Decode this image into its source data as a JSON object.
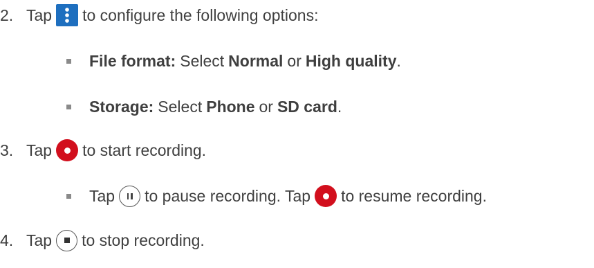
{
  "steps": {
    "s2": {
      "num": "2.",
      "pre": "Tap",
      "post": "to configure the following options:",
      "icon": "more-vert-icon",
      "icon_color": "#1e6fbf"
    },
    "opt1": {
      "label": "File format:",
      "t1": "Select",
      "b1": "Normal",
      "t2": "or",
      "b2": "High quality",
      "end": "."
    },
    "opt2": {
      "label": "Storage:",
      "t1": "Select",
      "b1": "Phone",
      "t2": "or",
      "b2": "SD card",
      "end": "."
    },
    "s3": {
      "num": "3.",
      "pre": "Tap",
      "post": "to start recording.",
      "icon": "record-icon",
      "icon_color": "#d20f1d"
    },
    "s3sub": {
      "pre": "Tap",
      "mid": "to pause recording. Tap",
      "post": "to resume recording.",
      "icon1": "pause-icon",
      "icon2": "record-icon"
    },
    "s4": {
      "num": "4.",
      "pre": "Tap",
      "post": "to stop recording.",
      "icon": "stop-icon"
    }
  }
}
